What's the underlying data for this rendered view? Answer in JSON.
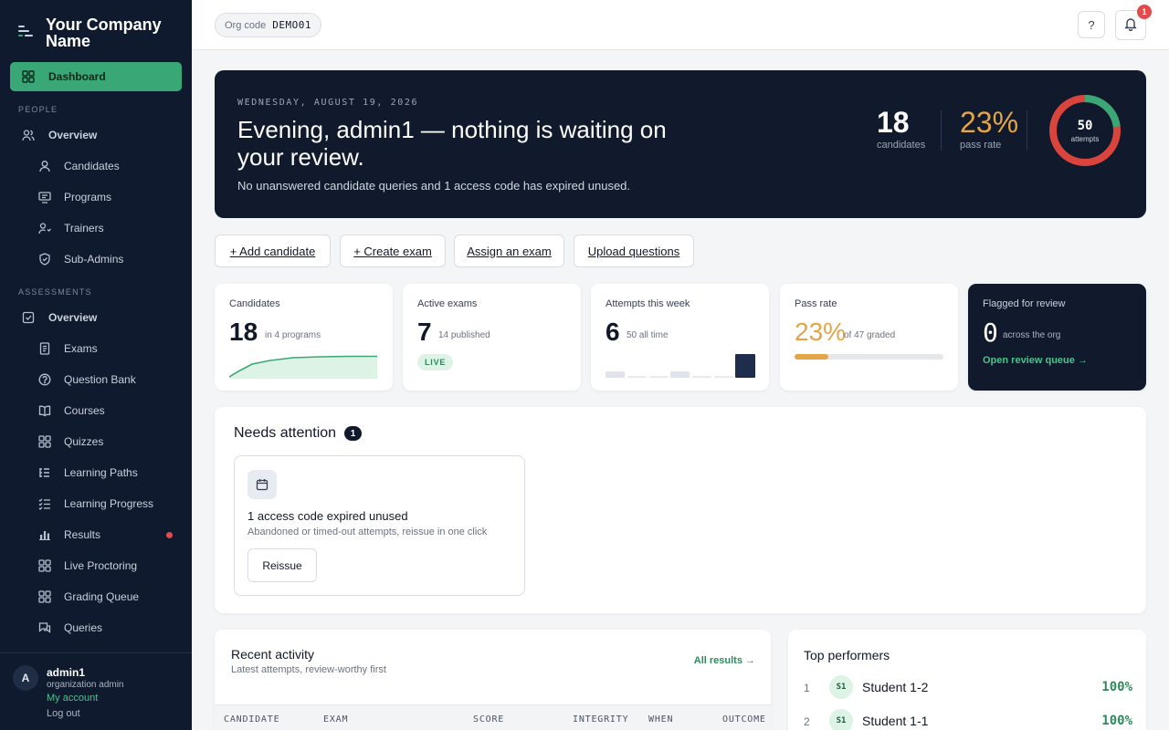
{
  "brand": {
    "name": "Your Company Name"
  },
  "sidebar": {
    "dashboard": "Dashboard",
    "section_people": "PEOPLE",
    "people": [
      {
        "label": "Overview",
        "icon": "users-icon"
      },
      {
        "label": "Candidates",
        "icon": "user-icon"
      },
      {
        "label": "Programs",
        "icon": "monitor-icon"
      },
      {
        "label": "Trainers",
        "icon": "trainer-icon"
      },
      {
        "label": "Sub-Admins",
        "icon": "shield-icon"
      }
    ],
    "section_assessments": "ASSESSMENTS",
    "assessments": [
      {
        "label": "Overview",
        "icon": "checkbox-icon"
      },
      {
        "label": "Exams",
        "icon": "document-icon"
      },
      {
        "label": "Question Bank",
        "icon": "question-icon"
      },
      {
        "label": "Courses",
        "icon": "book-icon"
      },
      {
        "label": "Quizzes",
        "icon": "grid-icon"
      },
      {
        "label": "Learning Paths",
        "icon": "list-icon"
      },
      {
        "label": "Learning Progress",
        "icon": "checklist-icon"
      },
      {
        "label": "Results",
        "icon": "bar-chart-icon"
      },
      {
        "label": "Live Proctoring",
        "icon": "grid-icon"
      },
      {
        "label": "Grading Queue",
        "icon": "grid-icon"
      },
      {
        "label": "Queries",
        "icon": "chat-icon"
      }
    ]
  },
  "user": {
    "initial": "A",
    "name": "admin1",
    "role": "organization admin",
    "my_account": "My account",
    "logout": "Log out"
  },
  "topbar": {
    "org_label": "Org code",
    "org_code": "DEMO01",
    "help": "?",
    "notifications_count": "1"
  },
  "hero": {
    "date": "WEDNESDAY, AUGUST 19, 2026",
    "title": "Evening, admin1 — nothing is waiting on your review.",
    "subtitle": "No unanswered candidate queries and 1 access code has expired unused.",
    "candidates_value": "18",
    "candidates_label": "candidates",
    "pass_rate_value": "23%",
    "pass_rate_label": "pass rate",
    "attempts_value": "50",
    "attempts_label": "attempts",
    "donut_fraction": 0.23
  },
  "actions": {
    "add_candidate": "+ Add candidate",
    "create_exam": "+ Create exam",
    "assign_exam": "Assign an exam",
    "upload_questions": "Upload questions"
  },
  "cards": {
    "candidates": {
      "title": "Candidates",
      "value": "18",
      "note": "in 4 programs"
    },
    "active_exams": {
      "title": "Active exams",
      "value": "7",
      "note": "14 published",
      "tag": "LIVE"
    },
    "attempts": {
      "title": "Attempts this week",
      "value": "6",
      "note": "50 all time"
    },
    "pass_rate": {
      "title": "Pass rate",
      "value": "23%",
      "note": "of 47 graded",
      "fraction": 0.23
    },
    "flagged": {
      "title": "Flagged for review",
      "value": "0",
      "note": "across the org",
      "link": "Open review queue →"
    }
  },
  "attention": {
    "title": "Needs attention",
    "count": "1",
    "item_title": "1 access code expired unused",
    "item_desc": "Abandoned or timed-out attempts, reissue in one click",
    "button": "Reissue"
  },
  "recent": {
    "title": "Recent activity",
    "subtitle": "Latest attempts, review-worthy first",
    "link": "All results →",
    "columns": [
      "CANDIDATE",
      "EXAM",
      "SCORE",
      "INTEGRITY",
      "WHEN",
      "OUTCOME"
    ]
  },
  "performers": {
    "title": "Top performers",
    "rows": [
      {
        "rank": "1",
        "initials": "S1",
        "name": "Student 1-2",
        "score": "100%"
      },
      {
        "rank": "2",
        "initials": "S1",
        "name": "Student 1-1",
        "score": "100%"
      }
    ]
  },
  "colors": {
    "accent": "#3aa876",
    "gold": "#e3a545",
    "danger": "#e24b4b",
    "navy": "#101a2c"
  }
}
